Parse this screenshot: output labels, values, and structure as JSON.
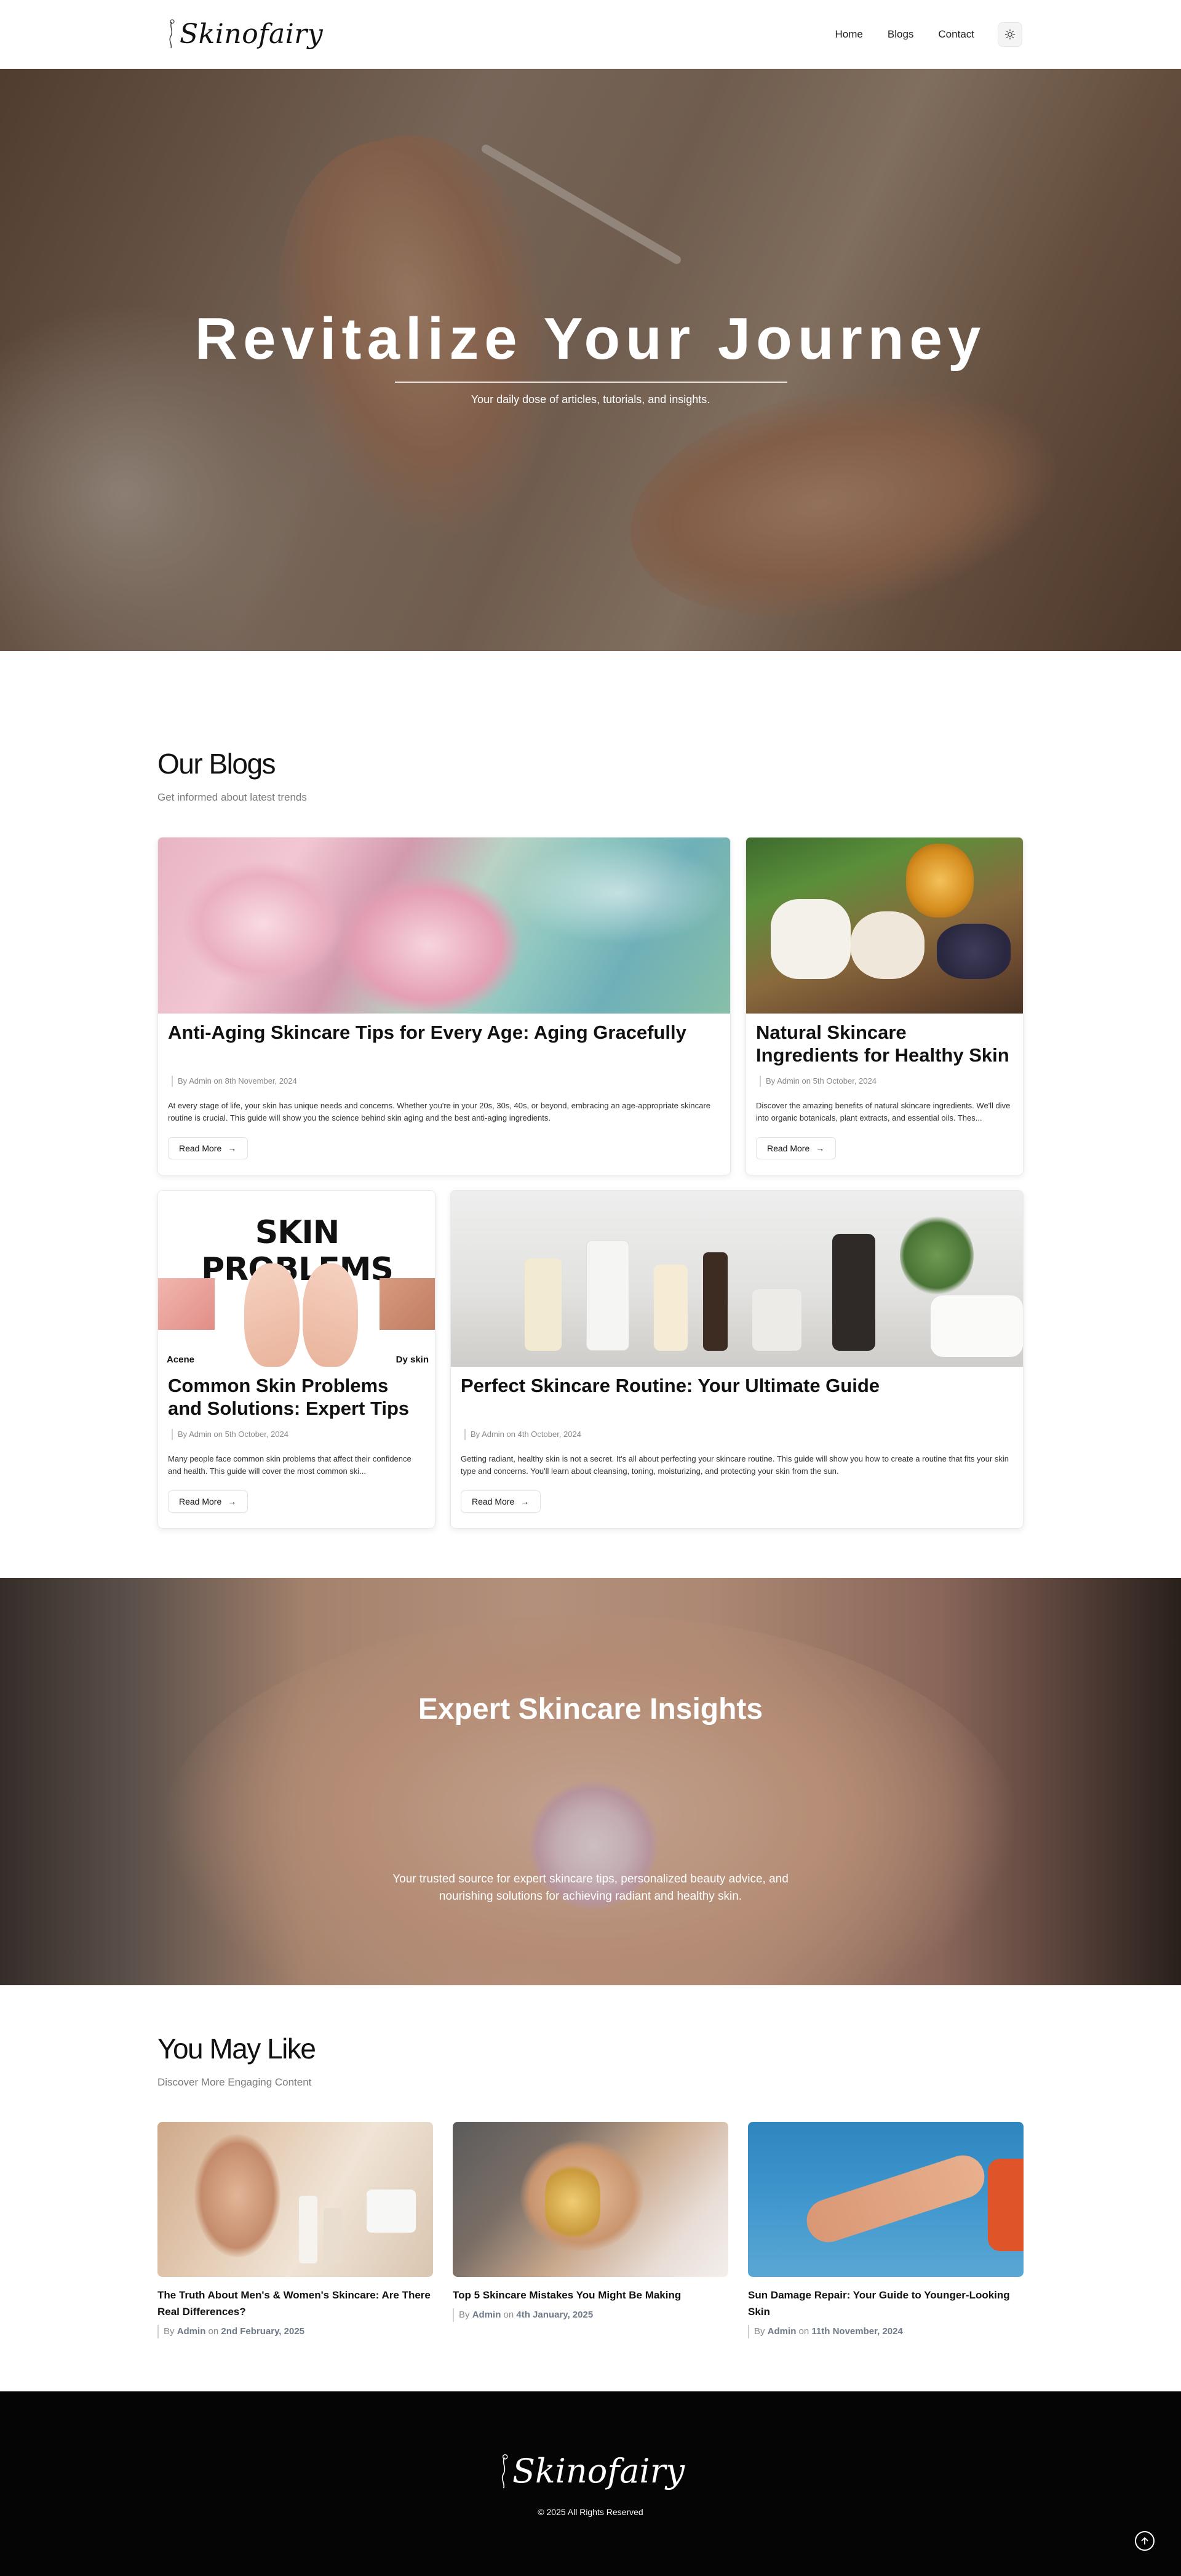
{
  "brand": {
    "name": "Skinofairy"
  },
  "nav": {
    "items": [
      "Home",
      "Blogs",
      "Contact"
    ],
    "theme_icon": "sun-icon"
  },
  "hero": {
    "title": "Revitalize Your Journey",
    "subtitle": "Your daily dose of articles, tutorials, and insights."
  },
  "blogs": {
    "title": "Our Blogs",
    "subtitle": "Get informed about latest trends",
    "read_more": "Read More",
    "cards": [
      {
        "title": "Anti-Aging Skincare Tips for Every Age: Aging Gracefully",
        "meta": "By Admin on 8th November, 2024",
        "excerpt": "At every stage of life, your skin has unique needs and concerns. Whether you're in your 20s, 30s, 40s, or beyond, embracing an age-appropriate skincare routine is crucial. This guide will show you the science behind skin aging and the best anti-aging ingredients."
      },
      {
        "title": "Natural Skincare Ingredients for Healthy Skin",
        "meta": "By Admin on 5th October, 2024",
        "excerpt": "Discover the amazing benefits of natural skincare ingredients. We'll dive into organic botanicals, plant extracts, and essential oils. Thes..."
      },
      {
        "title": "Common Skin Problems and Solutions: Expert Tips",
        "meta": "By Admin on 5th October, 2024",
        "excerpt": "Many people face common skin problems that affect their confidence and health. This guide will cover the most common ski...",
        "image_text": {
          "banner": "SKIN PROBLEMS",
          "left": "Acene",
          "right": "Dy skin"
        }
      },
      {
        "title": "Perfect Skincare Routine: Your Ultimate Guide",
        "meta": "By Admin on 4th October, 2024",
        "excerpt": "Getting radiant, healthy skin is not a secret. It's all about perfecting your skincare routine. This guide will show you how to create a routine that fits your skin type and concerns. You'll learn about cleansing, toning, moisturizing, and protecting your skin from the sun."
      }
    ]
  },
  "insights": {
    "title": "Expert Skincare Insights",
    "text": "Your trusted source for expert skincare tips, personalized beauty advice, and nourishing solutions for achieving radiant and healthy skin."
  },
  "you_may_like": {
    "title": "You May Like",
    "subtitle": "Discover More Engaging Content",
    "items": [
      {
        "title": "The Truth About Men's & Women's Skincare: Are There Real Differences?",
        "by": "By",
        "author": "Admin",
        "on": "on",
        "date": "2nd February, 2025"
      },
      {
        "title": "Top 5 Skincare Mistakes You Might Be Making",
        "by": "By",
        "author": "Admin",
        "on": "on",
        "date": "4th January, 2025"
      },
      {
        "title": "Sun Damage Repair: Your Guide to Younger-Looking Skin",
        "by": "By",
        "author": "Admin",
        "on": "on",
        "date": "11th November, 2024"
      }
    ]
  },
  "footer": {
    "copyright": "© 2025 All Rights Reserved",
    "top_icon": "arrow-up-circle-icon"
  },
  "colors": {
    "accent": "#111111",
    "meta": "#8a8a8a",
    "footer_bg": "#050505"
  }
}
